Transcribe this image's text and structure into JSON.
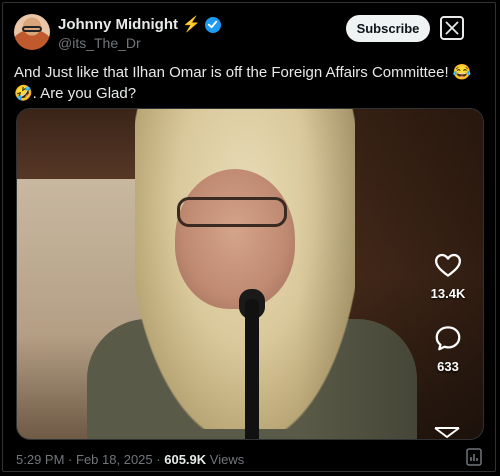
{
  "author": {
    "display_name": "Johnny Midnight",
    "badge_emoji": "⚡",
    "handle": "@its_The_Dr"
  },
  "header": {
    "subscribe_label": "Subscribe"
  },
  "tweet": {
    "text": "And Just like that Ilhan Omar is off the Foreign Affairs Committee! 😂🤣. Are you Glad?"
  },
  "media": {
    "like_count": "13.4K",
    "reply_count": "633"
  },
  "meta": {
    "time": "5:29 PM",
    "separator": "·",
    "date": "Feb 18, 2025",
    "views_count": "605.9K",
    "views_label": "Views"
  },
  "colors": {
    "verified": "#1d9bf0",
    "bolt": "#f7c21a",
    "text_primary": "#e7e9ea",
    "text_secondary": "#71767b"
  }
}
